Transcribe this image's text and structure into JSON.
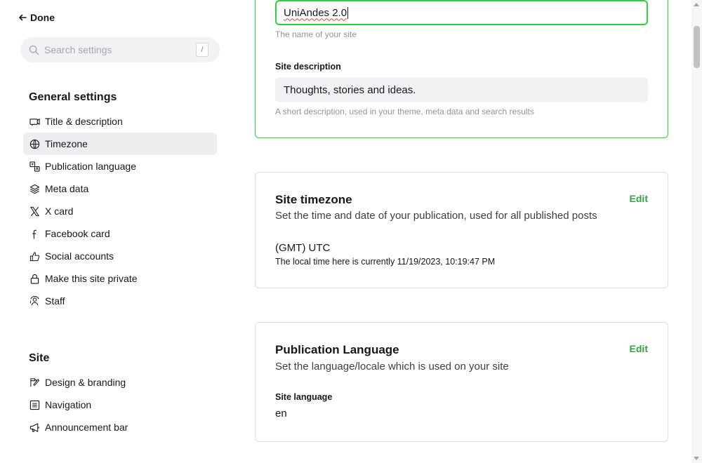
{
  "header": {
    "done_label": "Done"
  },
  "search": {
    "placeholder": "Search settings",
    "shortcut": "/"
  },
  "sidebar": {
    "general_title": "General settings",
    "general_items": [
      {
        "label": "Title & description",
        "icon": "megaphone-screen-icon"
      },
      {
        "label": "Timezone",
        "icon": "globe-icon",
        "active": true
      },
      {
        "label": "Publication language",
        "icon": "translate-icon"
      },
      {
        "label": "Meta data",
        "icon": "layers-icon"
      },
      {
        "label": "X card",
        "icon": "x-logo-icon"
      },
      {
        "label": "Facebook card",
        "icon": "facebook-icon"
      },
      {
        "label": "Social accounts",
        "icon": "thumbs-up-icon"
      },
      {
        "label": "Make this site private",
        "icon": "lock-icon"
      },
      {
        "label": "Staff",
        "icon": "users-icon"
      }
    ],
    "site_title": "Site",
    "site_items": [
      {
        "label": "Design & branding",
        "icon": "brush-icon"
      },
      {
        "label": "Navigation",
        "icon": "list-icon"
      },
      {
        "label": "Announcement bar",
        "icon": "megaphone-icon"
      }
    ]
  },
  "title_card": {
    "site_title_value": "UniAndes 2.0",
    "site_title_hint": "The name of your site",
    "description_label": "Site description",
    "description_value": "Thoughts, stories and ideas.",
    "description_hint": "A short description, used in your theme, meta data and search results"
  },
  "timezone_card": {
    "title": "Site timezone",
    "description": "Set the time and date of your publication, used for all published posts",
    "edit_label": "Edit",
    "timezone_value": "(GMT) UTC",
    "local_time": "The local time here is currently 11/19/2023, 10:19:47 PM"
  },
  "language_card": {
    "title": "Publication Language",
    "description": "Set the language/locale which is used on your site",
    "edit_label": "Edit",
    "field_label": "Site language",
    "field_value": "en"
  },
  "colors": {
    "accent": "#30cf43",
    "accent_text": "#30a43e",
    "active_bg": "#eceef0"
  }
}
